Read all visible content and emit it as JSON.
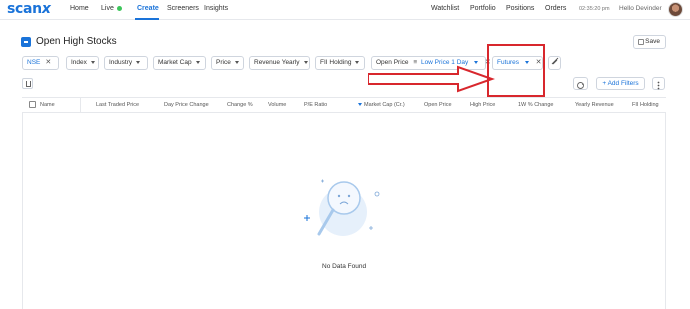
{
  "nav": {
    "logo": "scan",
    "logo_x": "x",
    "items": [
      {
        "label": "Home",
        "active": false
      },
      {
        "label": "Live",
        "active": false
      },
      {
        "label": "Create",
        "active": true
      },
      {
        "label": "Screeners",
        "active": false
      },
      {
        "label": "Insights",
        "active": false
      }
    ],
    "right_items": [
      "Watchlist",
      "Portfolio",
      "Positions",
      "Orders"
    ],
    "time": "02:35:20 pm",
    "greeting": "Hello Devinder",
    "live_status_color": "#3cc55a"
  },
  "page": {
    "title": "Open High Stocks",
    "save_label": "Save"
  },
  "filters": {
    "chips": [
      {
        "label": "NSE",
        "blue": true,
        "has_close": true,
        "has_caret": false
      },
      {
        "label": "Index",
        "blue": false,
        "has_close": false,
        "has_caret": true
      },
      {
        "label": "Industry",
        "blue": false,
        "has_close": false,
        "has_caret": true
      },
      {
        "label": "Market Cap",
        "blue": false,
        "has_close": false,
        "has_caret": true
      },
      {
        "label": "Price",
        "blue": false,
        "has_close": false,
        "has_caret": true
      },
      {
        "label": "Revenue Yearly",
        "blue": false,
        "has_close": false,
        "has_caret": true
      },
      {
        "label": "FII Holding",
        "blue": false,
        "has_close": false,
        "has_caret": true
      },
      {
        "label": "Open Price",
        "blue": false,
        "has_close": true,
        "extra": "Low Price 1 Day"
      },
      {
        "label": "Futures",
        "blue": true,
        "has_close": true,
        "has_caret": true
      }
    ],
    "add_filters_label": "+ Add Filters"
  },
  "table": {
    "columns": [
      "Name",
      "Last Traded Price",
      "Day Price Change",
      "Change %",
      "Volume",
      "P/E Ratio",
      "Market Cap (Cr.)",
      "Open Price",
      "High Price",
      "1W % Change",
      "Yearly Revenue",
      "FII Holding"
    ],
    "empty_message": "No Data Found"
  },
  "colors": {
    "accent": "#1a73d9",
    "highlight_box": "#d8272d"
  }
}
